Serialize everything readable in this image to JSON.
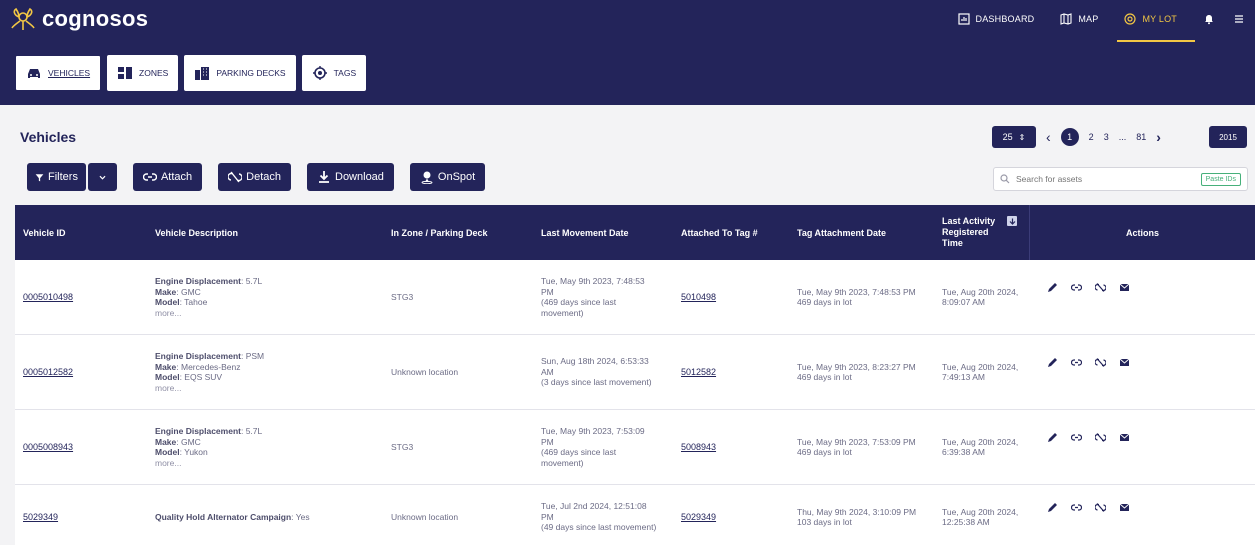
{
  "app": {
    "logo_text": "cognosos"
  },
  "topnav": [
    {
      "label": "DASHBOARD",
      "icon": "dashboard-icon"
    },
    {
      "label": "MAP",
      "icon": "map-icon"
    },
    {
      "label": "MY LOT",
      "icon": "location-icon",
      "active": true
    }
  ],
  "tabs": [
    {
      "label": "VEHICLES",
      "icon": "car-icon",
      "active": true
    },
    {
      "label": "ZONES",
      "icon": "zones-icon"
    },
    {
      "label": "PARKING DECKS",
      "icon": "building-icon"
    },
    {
      "label": "TAGS",
      "icon": "target-icon"
    }
  ],
  "section": {
    "title": "Vehicles"
  },
  "toolbar": {
    "filters_label": "Filters",
    "attach_label": "Attach",
    "detach_label": "Detach",
    "download_label": "Download",
    "onspot_label": "OnSpot"
  },
  "pager": {
    "per_page": "25",
    "pages": [
      "1",
      "2",
      "3",
      "...",
      "81"
    ],
    "current": "1",
    "total": "2015"
  },
  "search": {
    "placeholder": "Search for assets",
    "paste_label": "Paste IDs"
  },
  "table": {
    "headers": {
      "vehicle_id": "Vehicle ID",
      "description": "Vehicle Description",
      "zone": "In Zone / Parking Deck",
      "last_movement": "Last Movement Date",
      "attached_tag": "Attached To Tag #",
      "tag_attach_date": "Tag Attachment Date",
      "last_activity_1": "Last Activity",
      "last_activity_2": "Registered",
      "last_activity_3": "Time",
      "actions": "Actions"
    },
    "rows": [
      {
        "id": "0005010498",
        "desc": [
          {
            "k": "Engine Displacement",
            "v": ": 5.7L"
          },
          {
            "k": "Make",
            "v": ": GMC"
          },
          {
            "k": "Model",
            "v": ": Tahoe"
          }
        ],
        "more": "more...",
        "zone": "STG3",
        "move": [
          "Tue, May 9th 2023, 7:48:53",
          "PM",
          "(469 days since last",
          "movement)"
        ],
        "tag": "5010498",
        "attach": [
          "Tue, May 9th 2023, 7:48:53 PM",
          "469 days in lot"
        ],
        "activity": [
          "Tue, Aug 20th 2024,",
          "8:09:07 AM"
        ]
      },
      {
        "id": "0005012582",
        "desc": [
          {
            "k": "Engine Displacement",
            "v": ": PSM"
          },
          {
            "k": "Make",
            "v": ": Mercedes-Benz"
          },
          {
            "k": "Model",
            "v": ": EQS SUV"
          }
        ],
        "more": "more...",
        "zone": "Unknown location",
        "move": [
          "Sun, Aug 18th 2024, 6:53:33",
          "AM",
          "(3 days since last movement)"
        ],
        "tag": "5012582",
        "attach": [
          "Tue, May 9th 2023, 8:23:27 PM",
          "469 days in lot"
        ],
        "activity": [
          "Tue, Aug 20th 2024,",
          "7:49:13 AM"
        ]
      },
      {
        "id": "0005008943",
        "desc": [
          {
            "k": "Engine Displacement",
            "v": ": 5.7L"
          },
          {
            "k": "Make",
            "v": ": GMC"
          },
          {
            "k": "Model",
            "v": ": Yukon"
          }
        ],
        "more": "more...",
        "zone": "STG3",
        "move": [
          "Tue, May 9th 2023, 7:53:09",
          "PM",
          "(469 days since last",
          "movement)"
        ],
        "tag": "5008943",
        "attach": [
          "Tue, May 9th 2023, 7:53:09 PM",
          "469 days in lot"
        ],
        "activity": [
          "Tue, Aug 20th 2024,",
          "6:39:38 AM"
        ]
      },
      {
        "id": "5029349",
        "desc": [
          {
            "k": "Quality Hold Alternator Campaign",
            "v": ": Yes"
          }
        ],
        "more": "",
        "zone": "Unknown location",
        "move": [
          "Tue, Jul 2nd 2024, 12:51:08",
          "PM",
          "(49 days since last movement)"
        ],
        "tag": "5029349",
        "attach": [
          "Thu, May 9th 2024, 3:10:09 PM",
          "103 days in lot"
        ],
        "activity": [
          "Tue, Aug 20th 2024,",
          "12:25:38 AM"
        ]
      }
    ]
  },
  "colors": {
    "navy": "#23245a",
    "accent": "#f2c744",
    "paste": "#46b07a"
  }
}
